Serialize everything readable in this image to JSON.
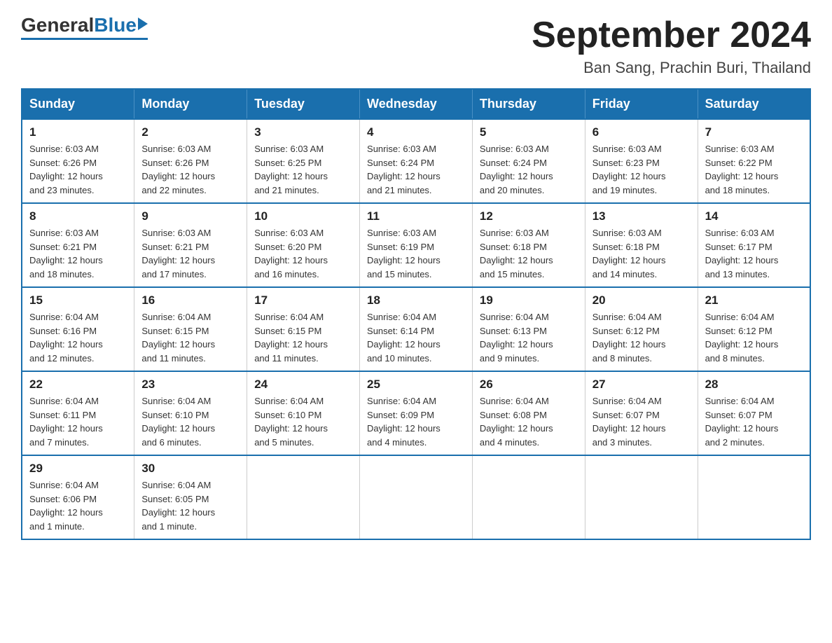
{
  "header": {
    "logo": {
      "general": "General",
      "blue": "Blue"
    },
    "title": "September 2024",
    "subtitle": "Ban Sang, Prachin Buri, Thailand"
  },
  "weekdays": [
    "Sunday",
    "Monday",
    "Tuesday",
    "Wednesday",
    "Thursday",
    "Friday",
    "Saturday"
  ],
  "weeks": [
    [
      {
        "day": "1",
        "sunrise": "6:03 AM",
        "sunset": "6:26 PM",
        "daylight": "12 hours and 23 minutes."
      },
      {
        "day": "2",
        "sunrise": "6:03 AM",
        "sunset": "6:26 PM",
        "daylight": "12 hours and 22 minutes."
      },
      {
        "day": "3",
        "sunrise": "6:03 AM",
        "sunset": "6:25 PM",
        "daylight": "12 hours and 21 minutes."
      },
      {
        "day": "4",
        "sunrise": "6:03 AM",
        "sunset": "6:24 PM",
        "daylight": "12 hours and 21 minutes."
      },
      {
        "day": "5",
        "sunrise": "6:03 AM",
        "sunset": "6:24 PM",
        "daylight": "12 hours and 20 minutes."
      },
      {
        "day": "6",
        "sunrise": "6:03 AM",
        "sunset": "6:23 PM",
        "daylight": "12 hours and 19 minutes."
      },
      {
        "day": "7",
        "sunrise": "6:03 AM",
        "sunset": "6:22 PM",
        "daylight": "12 hours and 18 minutes."
      }
    ],
    [
      {
        "day": "8",
        "sunrise": "6:03 AM",
        "sunset": "6:21 PM",
        "daylight": "12 hours and 18 minutes."
      },
      {
        "day": "9",
        "sunrise": "6:03 AM",
        "sunset": "6:21 PM",
        "daylight": "12 hours and 17 minutes."
      },
      {
        "day": "10",
        "sunrise": "6:03 AM",
        "sunset": "6:20 PM",
        "daylight": "12 hours and 16 minutes."
      },
      {
        "day": "11",
        "sunrise": "6:03 AM",
        "sunset": "6:19 PM",
        "daylight": "12 hours and 15 minutes."
      },
      {
        "day": "12",
        "sunrise": "6:03 AM",
        "sunset": "6:18 PM",
        "daylight": "12 hours and 15 minutes."
      },
      {
        "day": "13",
        "sunrise": "6:03 AM",
        "sunset": "6:18 PM",
        "daylight": "12 hours and 14 minutes."
      },
      {
        "day": "14",
        "sunrise": "6:03 AM",
        "sunset": "6:17 PM",
        "daylight": "12 hours and 13 minutes."
      }
    ],
    [
      {
        "day": "15",
        "sunrise": "6:04 AM",
        "sunset": "6:16 PM",
        "daylight": "12 hours and 12 minutes."
      },
      {
        "day": "16",
        "sunrise": "6:04 AM",
        "sunset": "6:15 PM",
        "daylight": "12 hours and 11 minutes."
      },
      {
        "day": "17",
        "sunrise": "6:04 AM",
        "sunset": "6:15 PM",
        "daylight": "12 hours and 11 minutes."
      },
      {
        "day": "18",
        "sunrise": "6:04 AM",
        "sunset": "6:14 PM",
        "daylight": "12 hours and 10 minutes."
      },
      {
        "day": "19",
        "sunrise": "6:04 AM",
        "sunset": "6:13 PM",
        "daylight": "12 hours and 9 minutes."
      },
      {
        "day": "20",
        "sunrise": "6:04 AM",
        "sunset": "6:12 PM",
        "daylight": "12 hours and 8 minutes."
      },
      {
        "day": "21",
        "sunrise": "6:04 AM",
        "sunset": "6:12 PM",
        "daylight": "12 hours and 8 minutes."
      }
    ],
    [
      {
        "day": "22",
        "sunrise": "6:04 AM",
        "sunset": "6:11 PM",
        "daylight": "12 hours and 7 minutes."
      },
      {
        "day": "23",
        "sunrise": "6:04 AM",
        "sunset": "6:10 PM",
        "daylight": "12 hours and 6 minutes."
      },
      {
        "day": "24",
        "sunrise": "6:04 AM",
        "sunset": "6:10 PM",
        "daylight": "12 hours and 5 minutes."
      },
      {
        "day": "25",
        "sunrise": "6:04 AM",
        "sunset": "6:09 PM",
        "daylight": "12 hours and 4 minutes."
      },
      {
        "day": "26",
        "sunrise": "6:04 AM",
        "sunset": "6:08 PM",
        "daylight": "12 hours and 4 minutes."
      },
      {
        "day": "27",
        "sunrise": "6:04 AM",
        "sunset": "6:07 PM",
        "daylight": "12 hours and 3 minutes."
      },
      {
        "day": "28",
        "sunrise": "6:04 AM",
        "sunset": "6:07 PM",
        "daylight": "12 hours and 2 minutes."
      }
    ],
    [
      {
        "day": "29",
        "sunrise": "6:04 AM",
        "sunset": "6:06 PM",
        "daylight": "12 hours and 1 minute."
      },
      {
        "day": "30",
        "sunrise": "6:04 AM",
        "sunset": "6:05 PM",
        "daylight": "12 hours and 1 minute."
      },
      null,
      null,
      null,
      null,
      null
    ]
  ]
}
